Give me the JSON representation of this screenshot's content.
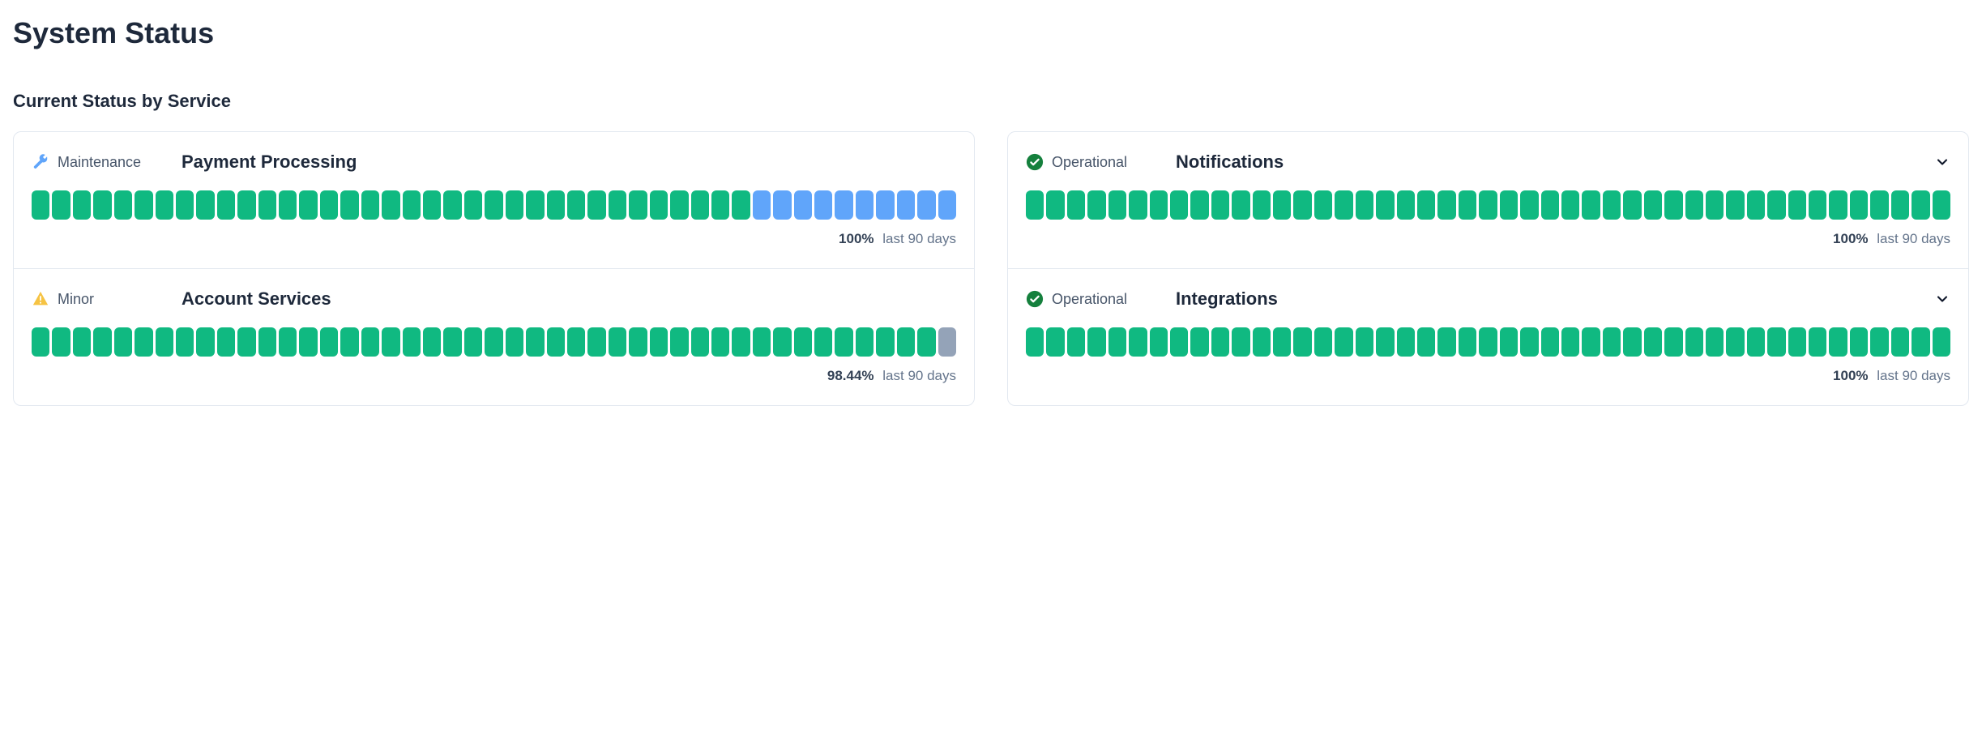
{
  "page": {
    "title": "System Status",
    "subsection": "Current Status by Service"
  },
  "uptime_period_label": "last 90 days",
  "status_labels": {
    "operational": "Operational",
    "maintenance": "Maintenance",
    "minor": "Minor"
  },
  "colors": {
    "ok": "#51a371",
    "maint": "#60a5fa",
    "down": "#94a3b8",
    "warn": "#f6c343",
    "check": "#15803d"
  },
  "columns": [
    {
      "cards": [
        {
          "id": "payment-processing",
          "status": "maintenance",
          "name": "Payment Processing",
          "uptime_pct": "100%",
          "expandable": false,
          "bars": {
            "total": 45,
            "segments": [
              {
                "state": "ok",
                "count": 35
              },
              {
                "state": "maint",
                "count": 10
              }
            ]
          }
        },
        {
          "id": "account-services",
          "status": "minor",
          "name": "Account Services",
          "uptime_pct": "98.44%",
          "expandable": false,
          "bars": {
            "total": 45,
            "segments": [
              {
                "state": "ok",
                "count": 44
              },
              {
                "state": "down",
                "count": 1
              }
            ]
          }
        }
      ]
    },
    {
      "cards": [
        {
          "id": "notifications",
          "status": "operational",
          "name": "Notifications",
          "uptime_pct": "100%",
          "expandable": true,
          "bars": {
            "total": 45,
            "segments": [
              {
                "state": "ok",
                "count": 45
              }
            ]
          }
        },
        {
          "id": "integrations",
          "status": "operational",
          "name": "Integrations",
          "uptime_pct": "100%",
          "expandable": true,
          "bars": {
            "total": 45,
            "segments": [
              {
                "state": "ok",
                "count": 45
              }
            ]
          }
        }
      ]
    }
  ]
}
